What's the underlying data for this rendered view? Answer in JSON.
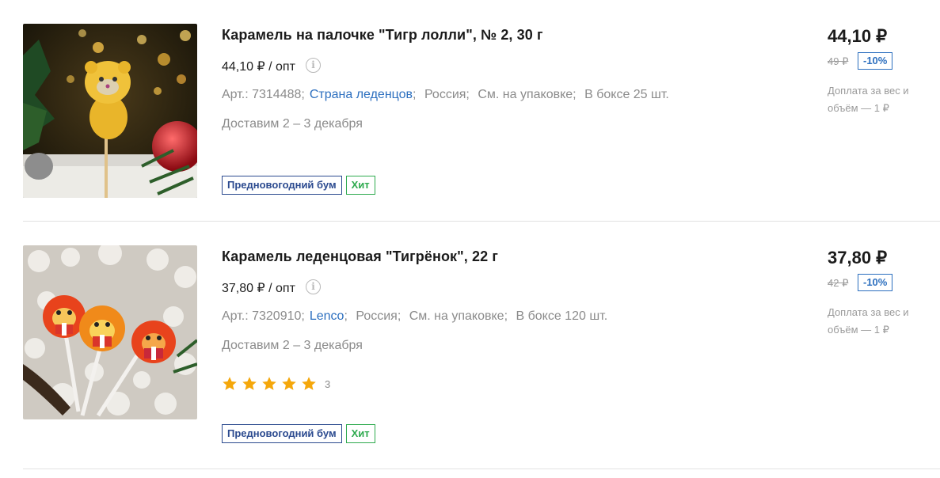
{
  "products": [
    {
      "title": "Карамель на палочке \"Тигр лолли\", № 2, 30 г",
      "opt_price": "44,10 ₽ / опт",
      "article": "Арт.: 7314488;",
      "brand": "Страна леденцов",
      "country": "Россия;",
      "composition": "См. на упаковке;",
      "box": "В боксе 25 шт.",
      "delivery": "Доставим 2 – 3 декабря",
      "tags": [
        "Предновогодний бум",
        "Хит"
      ],
      "price": "44,10 ₽",
      "old_price": "49 ₽",
      "discount": "-10%",
      "surcharge": "Доплата за вес и объём — 1 ₽"
    },
    {
      "title": "Карамель леденцовая \"Тигрёнок\", 22 г",
      "opt_price": "37,80 ₽ / опт",
      "article": "Арт.: 7320910;",
      "brand": "Lenco",
      "country": "Россия;",
      "composition": "См. на упаковке;",
      "box": "В боксе 120 шт.",
      "delivery": "Доставим 2 – 3 декабря",
      "rating_stars": 5,
      "rating_count": "3",
      "tags": [
        "Предновогодний бум",
        "Хит"
      ],
      "price": "37,80 ₽",
      "old_price": "42 ₽",
      "discount": "-10%",
      "surcharge": "Доплата за вес и объём — 1 ₽"
    }
  ],
  "colors": {
    "link": "#2c6fbf",
    "tag_blue": "#2b4a8f",
    "tag_green": "#2eaa4e",
    "star": "#f5a70a"
  },
  "icons": [
    "info-icon",
    "star-icon"
  ]
}
